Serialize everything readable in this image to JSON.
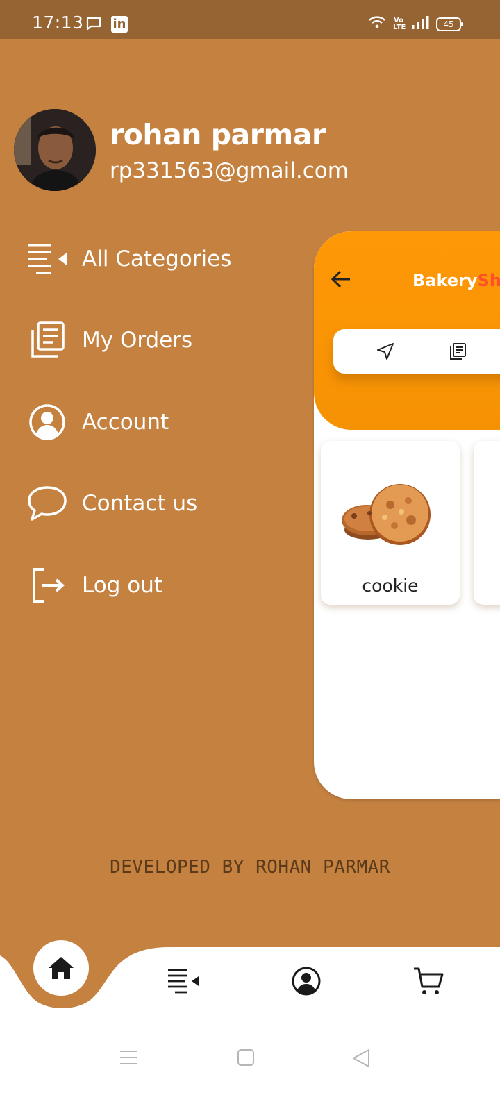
{
  "status_bar": {
    "time": "17:13",
    "battery": "45",
    "network_label": "Vo LTE"
  },
  "profile": {
    "name": "rohan parmar",
    "email": "rp331563@gmail.com"
  },
  "menu": {
    "items": [
      {
        "label": "All Categories",
        "icon": "categories-icon"
      },
      {
        "label": "My Orders",
        "icon": "orders-icon"
      },
      {
        "label": "Account",
        "icon": "account-icon"
      },
      {
        "label": "Contact us",
        "icon": "chat-icon"
      },
      {
        "label": "Log out",
        "icon": "logout-icon"
      }
    ]
  },
  "preview": {
    "title_part1": "Bakery",
    "title_part2": "Sh",
    "card_label": "cookie"
  },
  "footer": {
    "credit": "DEVELOPED BY ROHAN PARMAR"
  },
  "colors": {
    "drawer_bg": "#c58140",
    "status_bg": "#966332",
    "header_orange": "#ff9806",
    "accent_red": "#ff4f2b"
  }
}
